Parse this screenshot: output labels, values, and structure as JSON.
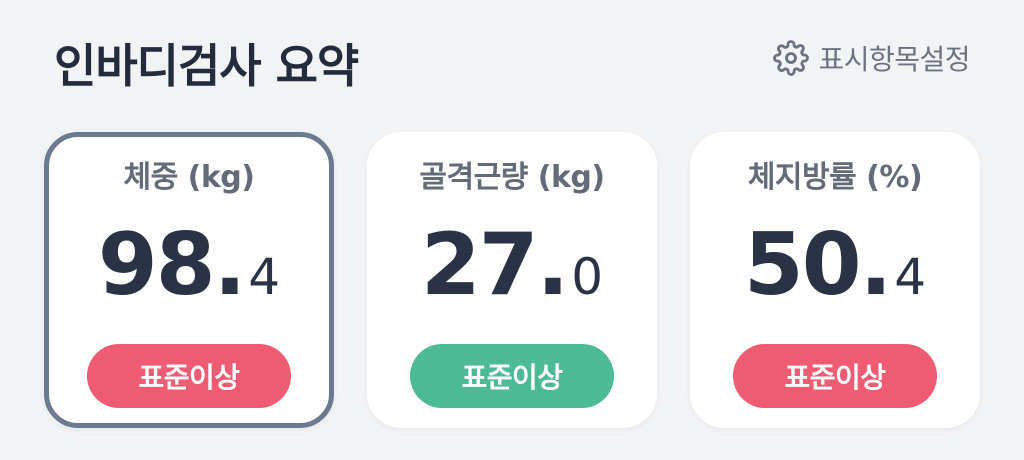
{
  "header": {
    "title": "인바디검사 요약",
    "settings_icon": "gear-icon",
    "settings_label": "표시항목설정"
  },
  "colors": {
    "badge_red": "#ef5b73",
    "badge_green": "#4cba95",
    "selected_border": "#6b7a8f",
    "background": "#f2f3f5"
  },
  "cards": [
    {
      "label": "체중 (kg)",
      "value_int": "98",
      "value_dec": "4",
      "badge": "표준이상",
      "badge_color": "#ef5b73",
      "selected": true
    },
    {
      "label": "골격근량 (kg)",
      "value_int": "27",
      "value_dec": "0",
      "badge": "표준이상",
      "badge_color": "#4cba95",
      "selected": false
    },
    {
      "label": "체지방률 (%)",
      "value_int": "50",
      "value_dec": "4",
      "badge": "표준이상",
      "badge_color": "#ef5b73",
      "selected": false
    }
  ]
}
